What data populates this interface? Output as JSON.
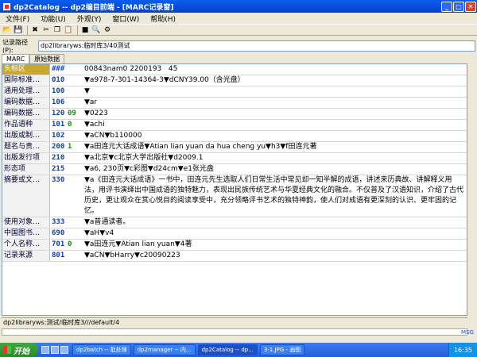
{
  "window": {
    "title": "dp2Catalog -- dp2编目前端 - [MARC记录窗]"
  },
  "menu": [
    "文件(F)",
    "功能(U)",
    "外观(Y)",
    "窗口(W)",
    "帮助(H)"
  ],
  "path": {
    "label": "记录路径(P):",
    "value": "dp2libraryws:临时库3/40测试"
  },
  "tabs": [
    "MARC",
    "原始数据"
  ],
  "marc": {
    "header": {
      "name": "头标区",
      "tag": "###",
      "content": "00843nam0 2200193   45"
    },
    "fields": [
      {
        "name": "国际标准…",
        "tag": "010",
        "ind": "",
        "content": "▼a978-7-301-14364-3▼dCNY39.00（含光盘）"
      },
      {
        "name": "通用处理…",
        "tag": "100",
        "ind": "",
        "content": "▼"
      },
      {
        "name": "编码数据…",
        "tag": "106",
        "ind": "",
        "content": "▼ar"
      },
      {
        "name": "编码数据…",
        "tag": "120",
        "ind": "09",
        "content": "▼0223"
      },
      {
        "name": "作品语种",
        "tag": "101",
        "ind": "0",
        "content": "▼achi"
      },
      {
        "name": "出版或制…",
        "tag": "102",
        "ind": "",
        "content": "▼aCN▼b110000"
      },
      {
        "name": "题名与责…",
        "tag": "200",
        "ind": "1",
        "content": "▼a田连元大话成语▼Atian lian yuan da hua cheng yu▼h3▼f田连元著"
      },
      {
        "name": "出版发行项",
        "tag": "210",
        "ind": "",
        "content": "▼a北京▼c北京大学出版社▼d2009.1"
      },
      {
        "name": "形态项",
        "tag": "215",
        "ind": "",
        "content": "▼a6, 230页▼c彩图▼d24cm▼e1张光盘"
      },
      {
        "name": "摘要或文…",
        "tag": "330",
        "ind": "",
        "content": "▼a《田连元大话成语》一书中，田连元先生选取人们日常生活中常见却一知半解的成语，讲述来历典故、讲解释义用法，用评书演绎出中国成语的独特魅力，表现出民族传统艺术与华夏经典文化的融合。不仅普及了汉语知识，介绍了古代历史，更让观众在赏心悦目的阅读享受中，充分领略评书艺术的独特神韵，使人们对成语有更深刻的认识、更牢固的记忆。"
      },
      {
        "name": "使用对象…",
        "tag": "333",
        "ind": "",
        "content": "▼a普通读者。"
      },
      {
        "name": "中国图书…",
        "tag": "690",
        "ind": "",
        "content": "▼aH▼v4"
      },
      {
        "name": "个人名称…",
        "tag": "701",
        "ind": "0",
        "content": "▼a田连元▼Atian lian yuan▼4著"
      },
      {
        "name": "记录来源",
        "tag": "801",
        "ind": "",
        "content": "▼aCN▼bHarry▼c20090223"
      }
    ]
  },
  "status": {
    "text": "dp2libraryws:测试/临时库3///default/4"
  },
  "tray_badge": "MSG",
  "taskbar": {
    "start": "开始",
    "tasks": [
      "dp2batch -- 批处理",
      "dp2manager -- 内...",
      "dp2Catalog -- dp...",
      "3-1.JPG - 画图"
    ],
    "active_index": 2,
    "clock": "16:35"
  }
}
